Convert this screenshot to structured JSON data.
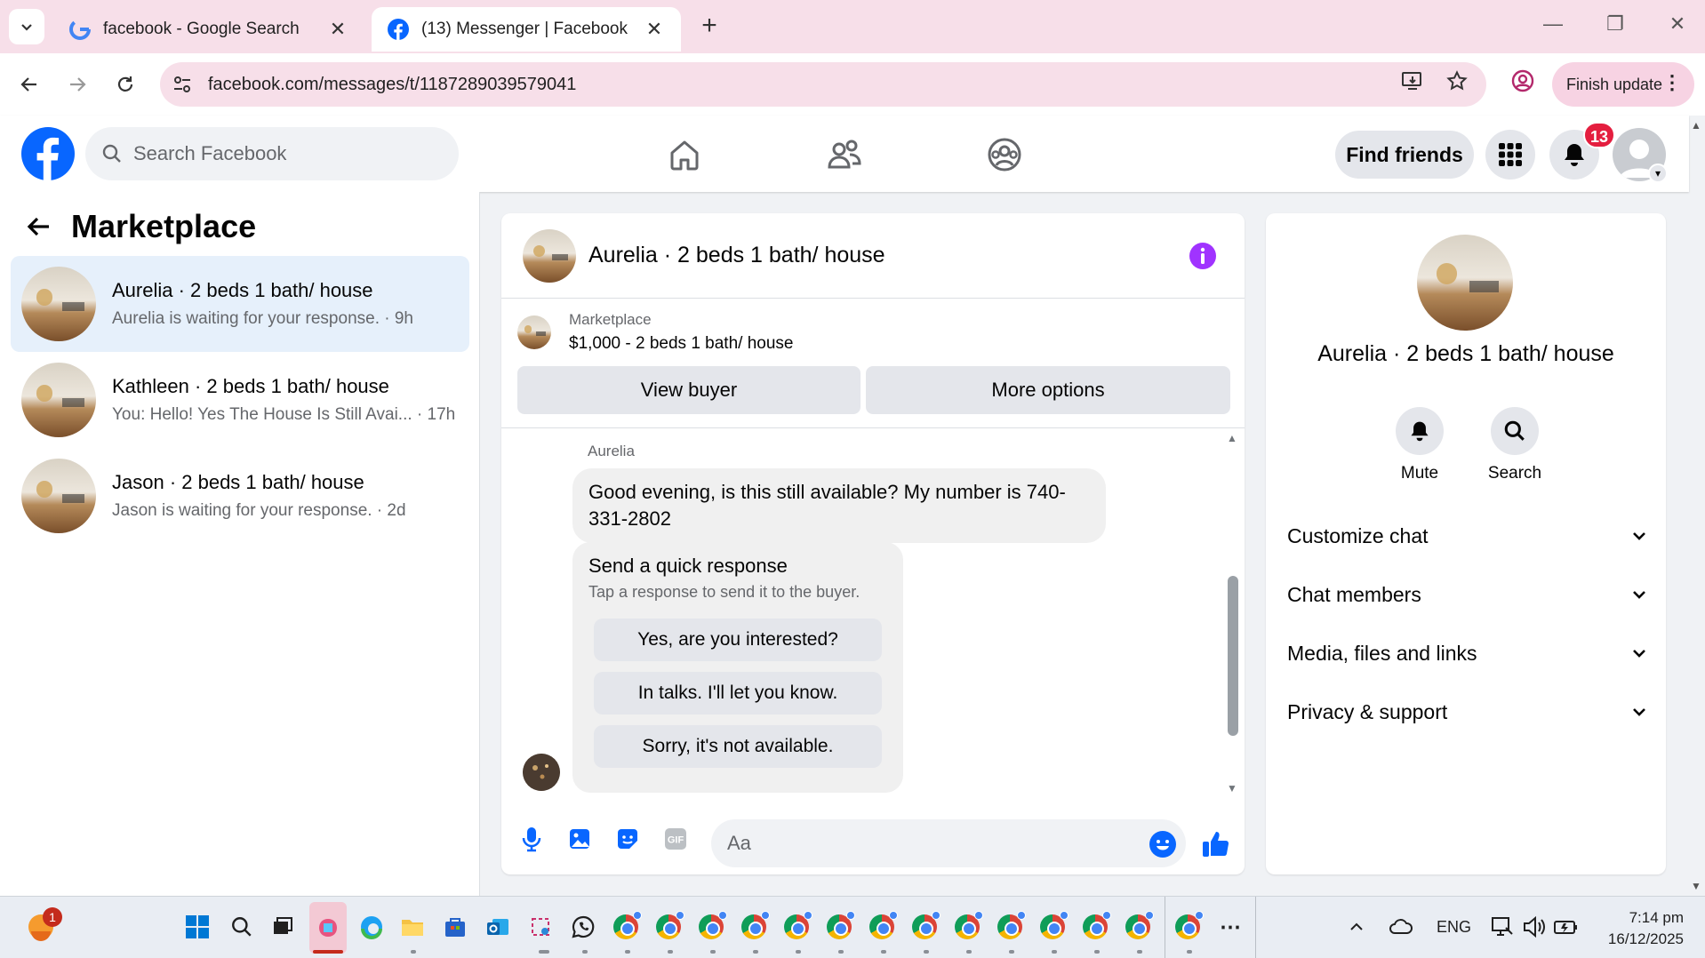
{
  "browser": {
    "tabs": [
      {
        "label": "facebook - Google Search",
        "icon": "google-icon"
      },
      {
        "label": "(13) Messenger | Facebook",
        "icon": "facebook-icon",
        "active": true
      }
    ],
    "url": "facebook.com/messages/t/1187289039579041",
    "finish_update_label": "Finish update"
  },
  "fb_header": {
    "search_placeholder": "Search Facebook",
    "find_friends_label": "Find friends",
    "notification_count": "13"
  },
  "left": {
    "title": "Marketplace",
    "conversations": [
      {
        "name": "Aurelia · 2 beds 1 bath/ house",
        "snippet": "Aurelia is waiting for your response. · 9h",
        "active": true
      },
      {
        "name": "Kathleen · 2 beds 1 bath/ house",
        "snippet": "You: Hello! Yes The House Is Still Avai... · 17h"
      },
      {
        "name": "Jason · 2 beds 1 bath/ house",
        "snippet": "Jason is waiting for your response. · 2d"
      }
    ]
  },
  "chat": {
    "title": "Aurelia · 2 beds 1 bath/ house",
    "marketplace_label": "Marketplace",
    "listing": "$1,000 - 2 beds 1 bath/ house",
    "view_buyer_label": "View buyer",
    "more_options_label": "More options",
    "sender": "Aurelia",
    "message": "Good evening, is this still available? My number is 740-331-2802",
    "quick_title": "Send a quick response",
    "quick_subtitle": "Tap a response to send it to the buyer.",
    "quick_responses": [
      "Yes, are you interested?",
      "In talks. I'll let you know.",
      "Sorry, it's not available."
    ],
    "input_placeholder": "Aa"
  },
  "right": {
    "name": "Aurelia · 2 beds 1 bath/ house",
    "actions": [
      {
        "label": "Mute",
        "icon": "bell-icon"
      },
      {
        "label": "Search",
        "icon": "search-icon"
      }
    ],
    "sections": [
      "Customize chat",
      "Chat members",
      "Media, files and links",
      "Privacy & support"
    ]
  },
  "taskbar": {
    "notification_badge": "1",
    "language": "ENG",
    "time": "7:14 pm",
    "date": "16/12/2025"
  },
  "colors": {
    "facebook_blue": "#0866ff",
    "messenger_purple": "#a033ff",
    "badge_red": "#e41e3f"
  }
}
